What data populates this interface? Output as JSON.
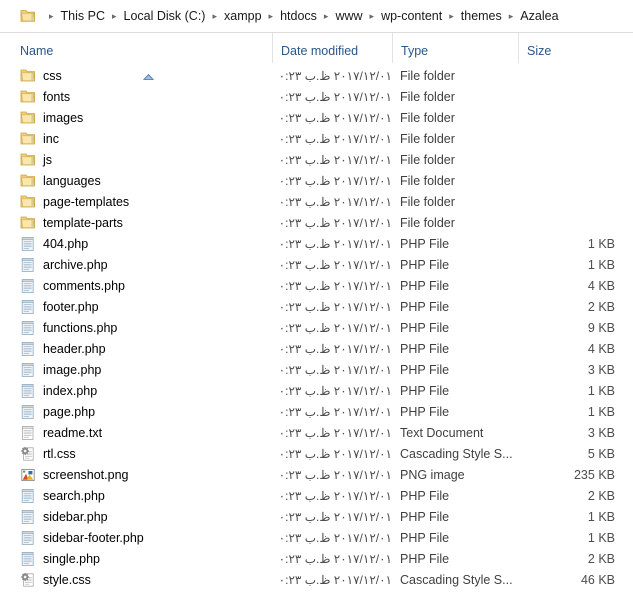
{
  "window": {
    "type": "file-explorer"
  },
  "breadcrumb": {
    "separator": "▸",
    "items": [
      {
        "label": "This PC"
      },
      {
        "label": "Local Disk (C:)"
      },
      {
        "label": "xampp"
      },
      {
        "label": "htdocs"
      },
      {
        "label": "www"
      },
      {
        "label": "wp-content"
      },
      {
        "label": "themes"
      },
      {
        "label": "Azalea"
      }
    ]
  },
  "columns": {
    "name": "Name",
    "date_modified": "Date modified",
    "type": "Type",
    "size": "Size",
    "sort_column": "Name",
    "sort_direction": "ascending"
  },
  "files": [
    {
      "name": "css",
      "date": "٢٠١٧/١٢/٠١ ظ.ب ١٠:٢٣",
      "type": "File folder",
      "size": "",
      "icon": "folder-icon"
    },
    {
      "name": "fonts",
      "date": "٢٠١٧/١٢/٠١ ظ.ب ١٠:٢٣",
      "type": "File folder",
      "size": "",
      "icon": "folder-icon"
    },
    {
      "name": "images",
      "date": "٢٠١٧/١٢/٠١ ظ.ب ١٠:٢٣",
      "type": "File folder",
      "size": "",
      "icon": "folder-icon"
    },
    {
      "name": "inc",
      "date": "٢٠١٧/١٢/٠١ ظ.ب ١٠:٢٣",
      "type": "File folder",
      "size": "",
      "icon": "folder-icon"
    },
    {
      "name": "js",
      "date": "٢٠١٧/١٢/٠١ ظ.ب ١٠:٢٣",
      "type": "File folder",
      "size": "",
      "icon": "folder-icon"
    },
    {
      "name": "languages",
      "date": "٢٠١٧/١٢/٠١ ظ.ب ١٠:٢٣",
      "type": "File folder",
      "size": "",
      "icon": "folder-icon"
    },
    {
      "name": "page-templates",
      "date": "٢٠١٧/١٢/٠١ ظ.ب ١٠:٢٣",
      "type": "File folder",
      "size": "",
      "icon": "folder-icon"
    },
    {
      "name": "template-parts",
      "date": "٢٠١٧/١٢/٠١ ظ.ب ١٠:٢٣",
      "type": "File folder",
      "size": "",
      "icon": "folder-icon"
    },
    {
      "name": "404.php",
      "date": "٢٠١٧/١٢/٠١ ظ.ب ١٠:٢٣",
      "type": "PHP File",
      "size": "1 KB",
      "icon": "php-file-icon"
    },
    {
      "name": "archive.php",
      "date": "٢٠١٧/١٢/٠١ ظ.ب ١٠:٢٣",
      "type": "PHP File",
      "size": "1 KB",
      "icon": "php-file-icon"
    },
    {
      "name": "comments.php",
      "date": "٢٠١٧/١٢/٠١ ظ.ب ١٠:٢٣",
      "type": "PHP File",
      "size": "4 KB",
      "icon": "php-file-icon"
    },
    {
      "name": "footer.php",
      "date": "٢٠١٧/١٢/٠١ ظ.ب ١٠:٢٣",
      "type": "PHP File",
      "size": "2 KB",
      "icon": "php-file-icon"
    },
    {
      "name": "functions.php",
      "date": "٢٠١٧/١٢/٠١ ظ.ب ١٠:٢٣",
      "type": "PHP File",
      "size": "9 KB",
      "icon": "php-file-icon"
    },
    {
      "name": "header.php",
      "date": "٢٠١٧/١٢/٠١ ظ.ب ١٠:٢٣",
      "type": "PHP File",
      "size": "4 KB",
      "icon": "php-file-icon"
    },
    {
      "name": "image.php",
      "date": "٢٠١٧/١٢/٠١ ظ.ب ١٠:٢٣",
      "type": "PHP File",
      "size": "3 KB",
      "icon": "php-file-icon"
    },
    {
      "name": "index.php",
      "date": "٢٠١٧/١٢/٠١ ظ.ب ١٠:٢٣",
      "type": "PHP File",
      "size": "1 KB",
      "icon": "php-file-icon"
    },
    {
      "name": "page.php",
      "date": "٢٠١٧/١٢/٠١ ظ.ب ١٠:٢٣",
      "type": "PHP File",
      "size": "1 KB",
      "icon": "php-file-icon"
    },
    {
      "name": "readme.txt",
      "date": "٢٠١٧/١٢/٠١ ظ.ب ١٠:٢٣",
      "type": "Text Document",
      "size": "3 KB",
      "icon": "text-file-icon"
    },
    {
      "name": "rtl.css",
      "date": "٢٠١٧/١٢/٠١ ظ.ب ١٠:٢٣",
      "type": "Cascading Style S...",
      "size": "5 KB",
      "icon": "css-file-icon"
    },
    {
      "name": "screenshot.png",
      "date": "٢٠١٧/١٢/٠١ ظ.ب ١٠:٢٣",
      "type": "PNG image",
      "size": "235 KB",
      "icon": "png-image-icon"
    },
    {
      "name": "search.php",
      "date": "٢٠١٧/١٢/٠١ ظ.ب ١٠:٢٣",
      "type": "PHP File",
      "size": "2 KB",
      "icon": "php-file-icon"
    },
    {
      "name": "sidebar.php",
      "date": "٢٠١٧/١٢/٠١ ظ.ب ١٠:٢٣",
      "type": "PHP File",
      "size": "1 KB",
      "icon": "php-file-icon"
    },
    {
      "name": "sidebar-footer.php",
      "date": "٢٠١٧/١٢/٠١ ظ.ب ١٠:٢٣",
      "type": "PHP File",
      "size": "1 KB",
      "icon": "php-file-icon"
    },
    {
      "name": "single.php",
      "date": "٢٠١٧/١٢/٠١ ظ.ب ١٠:٢٣",
      "type": "PHP File",
      "size": "2 KB",
      "icon": "php-file-icon"
    },
    {
      "name": "style.css",
      "date": "٢٠١٧/١٢/٠١ ظ.ب ١٠:٢٣",
      "type": "Cascading Style S...",
      "size": "46 KB",
      "icon": "css-file-icon"
    }
  ],
  "colors": {
    "header_text": "#2b5786",
    "folder_body": "#f2d98c",
    "folder_edge": "#d6ab49",
    "accent_blue": "#4a7fb5"
  }
}
